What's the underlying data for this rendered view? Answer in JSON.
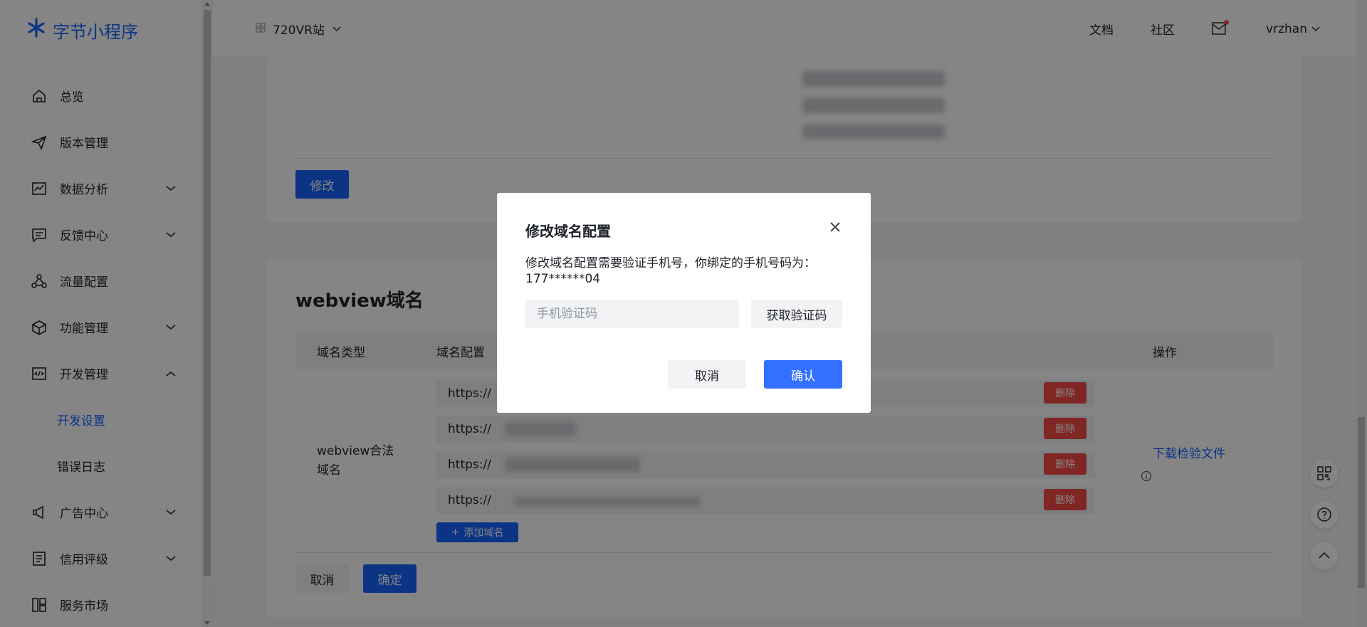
{
  "app": {
    "brand": "字节小程序"
  },
  "sidebar": {
    "items": [
      {
        "label": "总览",
        "icon": "home-icon"
      },
      {
        "label": "版本管理",
        "icon": "send-icon"
      },
      {
        "label": "数据分析",
        "icon": "chart-icon",
        "expandable": true
      },
      {
        "label": "反馈中心",
        "icon": "message-icon",
        "expandable": true
      },
      {
        "label": "流量配置",
        "icon": "flow-icon"
      },
      {
        "label": "功能管理",
        "icon": "box-icon",
        "expandable": true
      },
      {
        "label": "开发管理",
        "icon": "code-icon",
        "expanded": true
      },
      {
        "label": "广告中心",
        "icon": "megaphone-icon",
        "expandable": true
      },
      {
        "label": "信用评级",
        "icon": "list-icon",
        "expandable": true
      },
      {
        "label": "服务市场",
        "icon": "apps-icon"
      }
    ],
    "sub_items": [
      {
        "label": "开发设置",
        "active": true
      },
      {
        "label": "错误日志"
      }
    ]
  },
  "header": {
    "app_name": "720VR站",
    "docs": "文档",
    "community": "社区",
    "user": "vrzhan"
  },
  "main": {
    "modify_button": "修改",
    "webview_section": {
      "title": "webview域名",
      "columns": [
        "域名类型",
        "域名配置",
        "操作"
      ],
      "row_label": "webview合法域名",
      "domains": [
        {
          "protocol": "https://",
          "delete_label": "删除"
        },
        {
          "protocol": "https://",
          "delete_label": "删除"
        },
        {
          "protocol": "https://",
          "delete_label": "删除"
        },
        {
          "protocol": "https://",
          "delete_label": "删除"
        }
      ],
      "add_domain": "添加域名",
      "download_link": "下载检验文件",
      "cancel": "取消",
      "confirm": "确定"
    }
  },
  "modal": {
    "title": "修改域名配置",
    "description": "修改域名配置需要验证手机号，你绑定的手机号码为：",
    "phone": "177******04",
    "code_placeholder": "手机验证码",
    "code_value": "",
    "get_code": "获取验证码",
    "cancel": "取消",
    "confirm": "确认"
  },
  "colors": {
    "brand": "#1664ff",
    "danger": "#f54a45",
    "modal_primary": "#3370ff"
  }
}
